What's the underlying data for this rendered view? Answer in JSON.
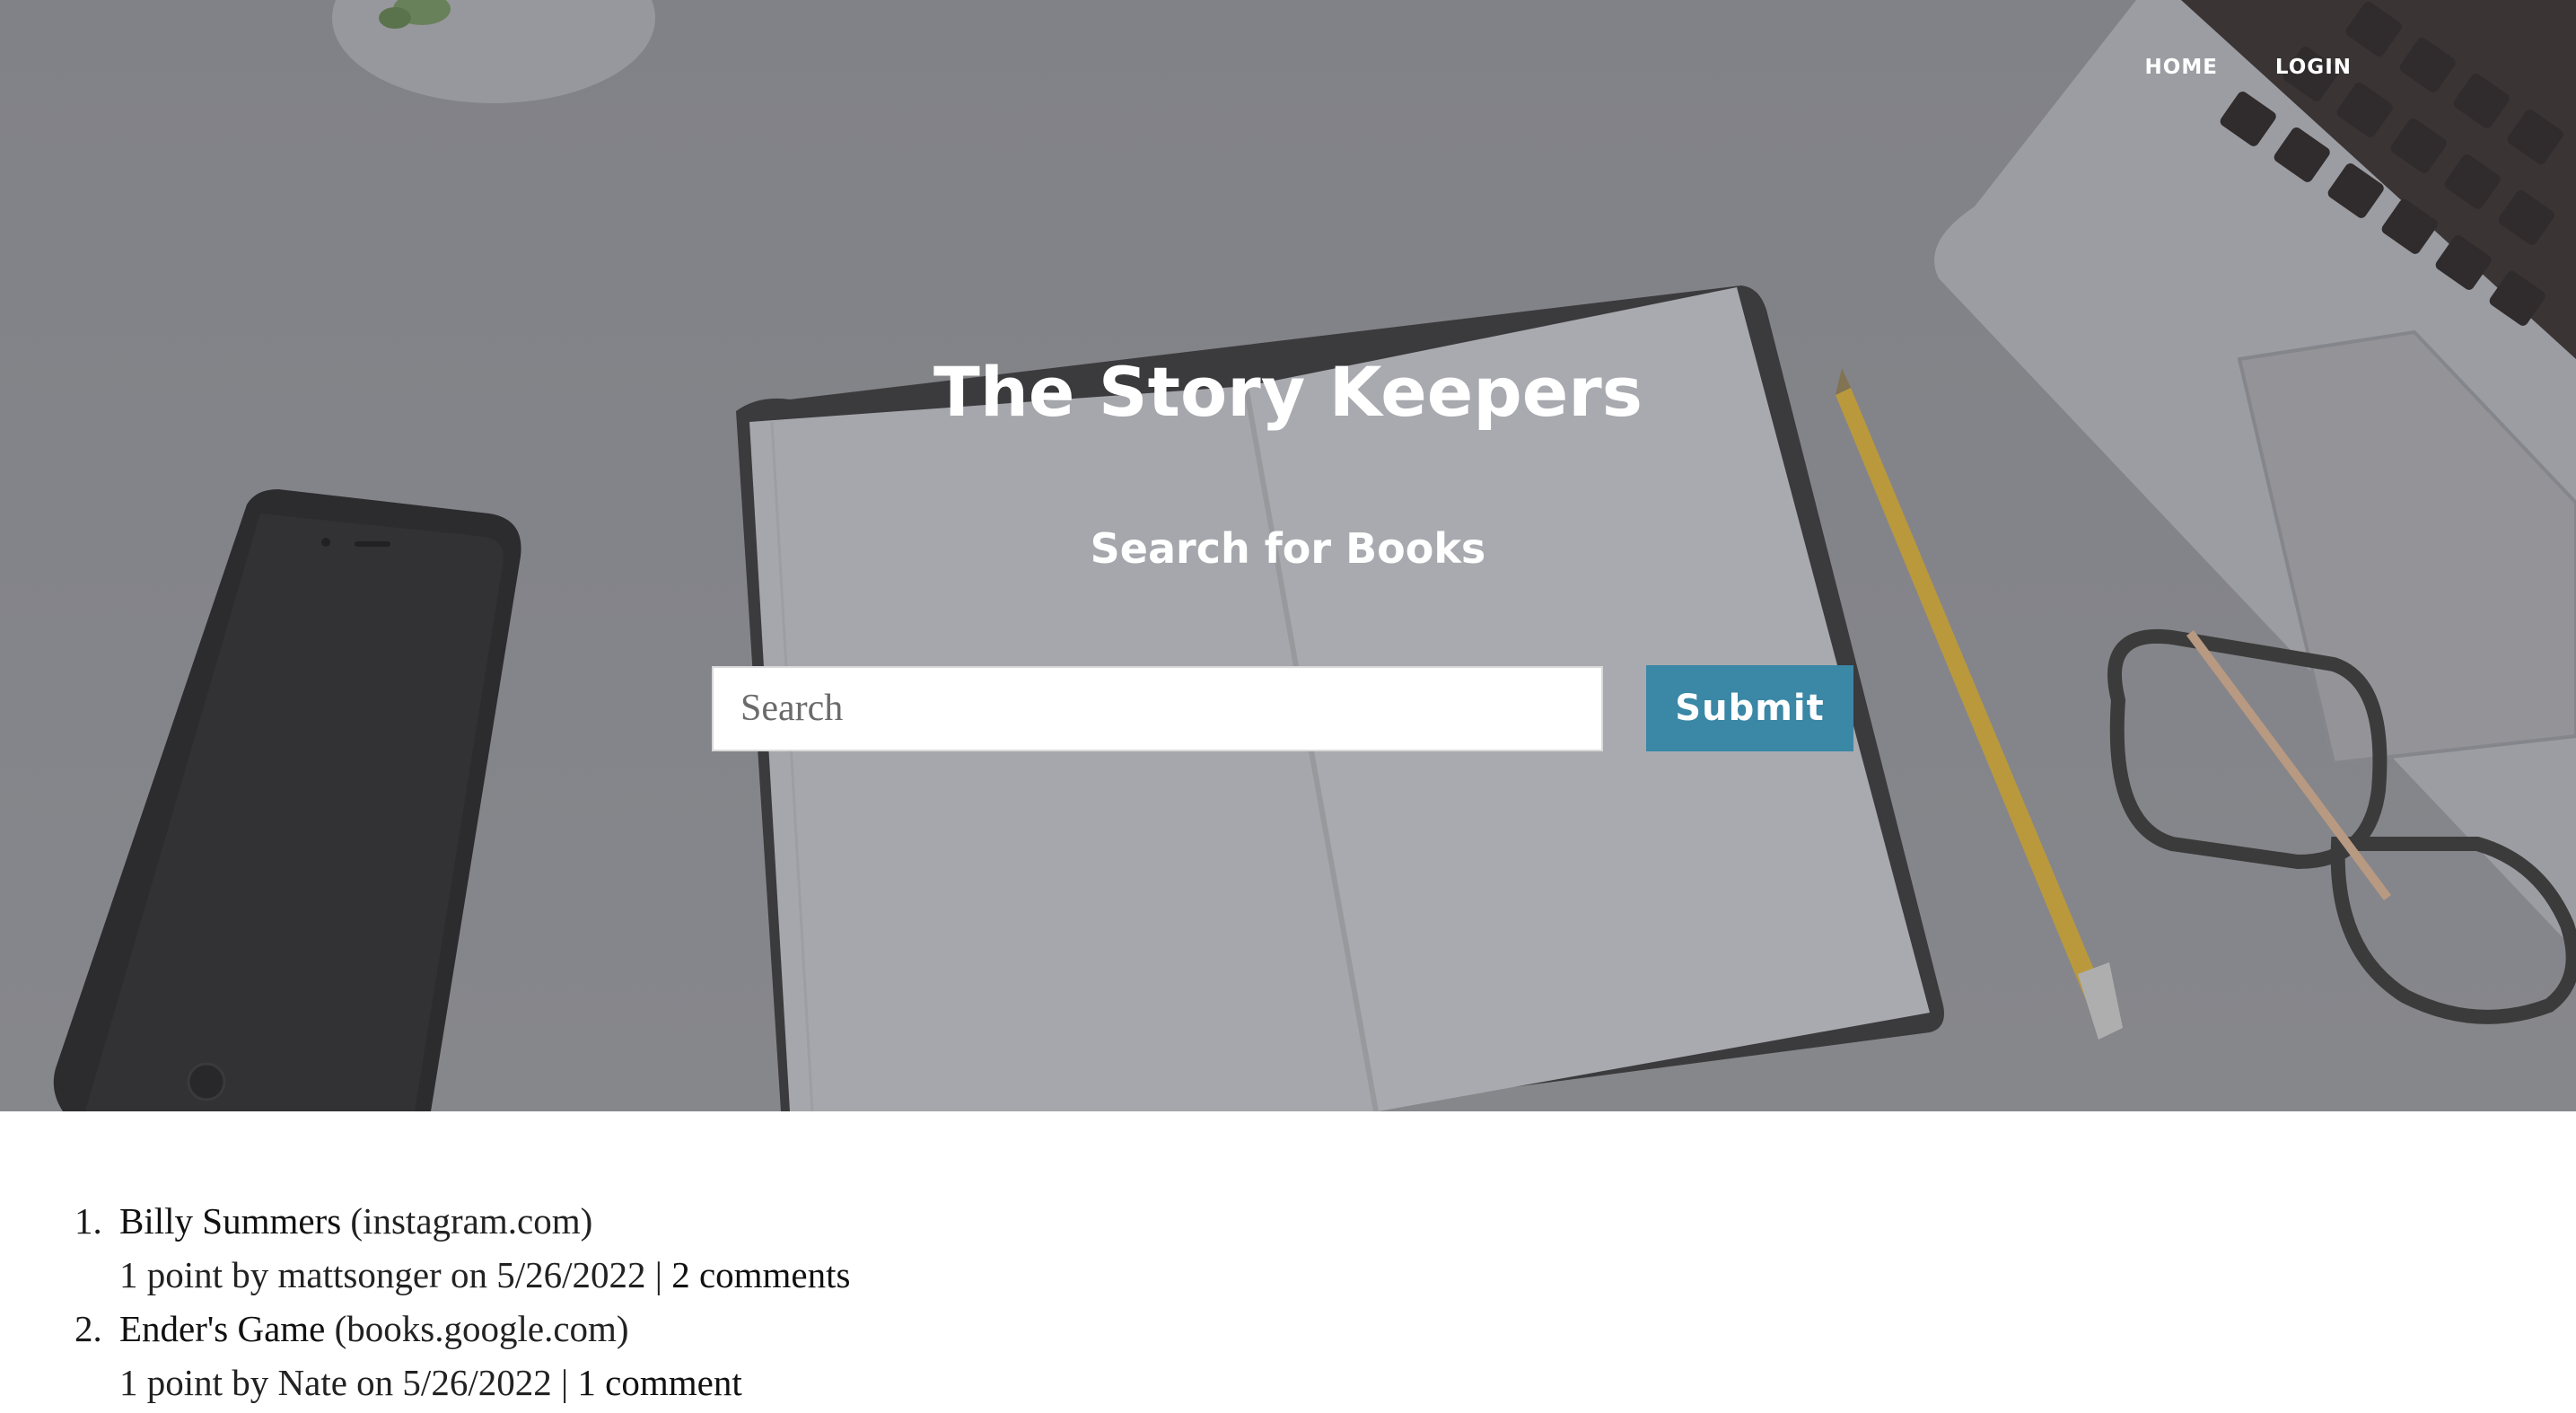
{
  "nav": {
    "home": "HOME",
    "login": "LOGIN"
  },
  "hero": {
    "title": "The Story Keepers",
    "subtitle": "Search for Books"
  },
  "search": {
    "placeholder": "Search",
    "value": "",
    "submit_label": "Submit"
  },
  "posts": [
    {
      "number": "1.",
      "title": "Billy Summers",
      "domain": "(instagram.com)",
      "meta": "1 point by mattsonger on 5/26/2022 |",
      "comments": "2 comments"
    },
    {
      "number": "2.",
      "title": "Ender's Game",
      "domain": "(books.google.com)",
      "meta": "1 point by Nate on 5/26/2022 |",
      "comments": "1 comment"
    }
  ],
  "colors": {
    "accent": "#3a87a6",
    "hero_bg": "#8c8d91",
    "text": "#1a1a1a"
  }
}
